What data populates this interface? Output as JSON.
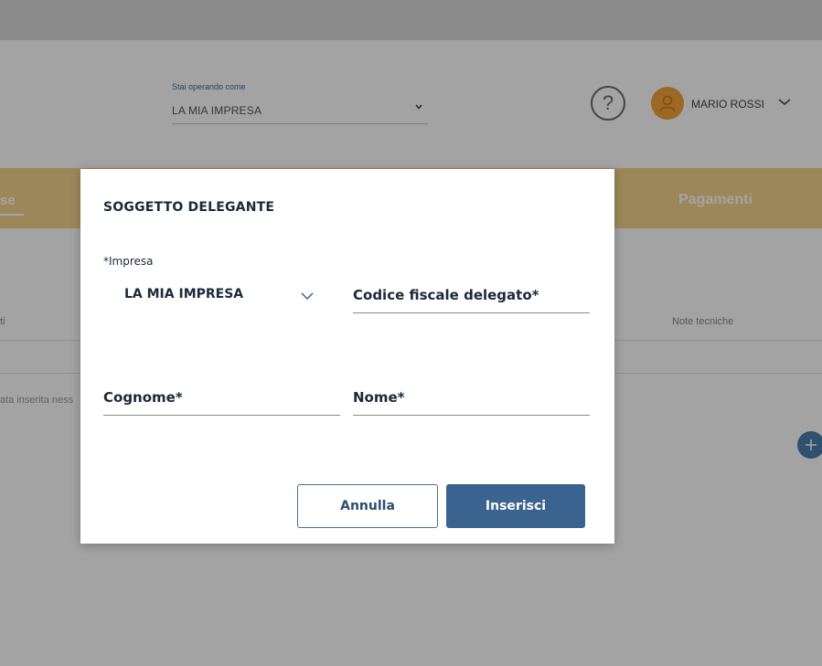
{
  "header": {
    "operating_label": "Stai operando come",
    "operating_value": "LA MIA IMPRESA",
    "help_glyph": "?",
    "user_name": "MARIO ROSSI"
  },
  "tabs": {
    "active_partial": "se",
    "pagamenti": "Pagamenti"
  },
  "table": {
    "col_left_partial": "ti",
    "col_right": "Note tecniche",
    "empty_partial": "ata inserita ness"
  },
  "modal": {
    "title": "SOGGETTO DELEGANTE",
    "impresa_label": "*Impresa",
    "impresa_value": "LA MIA IMPRESA",
    "codice_fiscale_placeholder": "Codice fiscale delegato*",
    "cognome_placeholder": "Cognome*",
    "nome_placeholder": "Nome*",
    "cancel_label": "Annulla",
    "submit_label": "Inserisci"
  },
  "colors": {
    "tabbar": "#f5d48e",
    "primary": "#3a638f",
    "avatar": "#f2a33a"
  }
}
